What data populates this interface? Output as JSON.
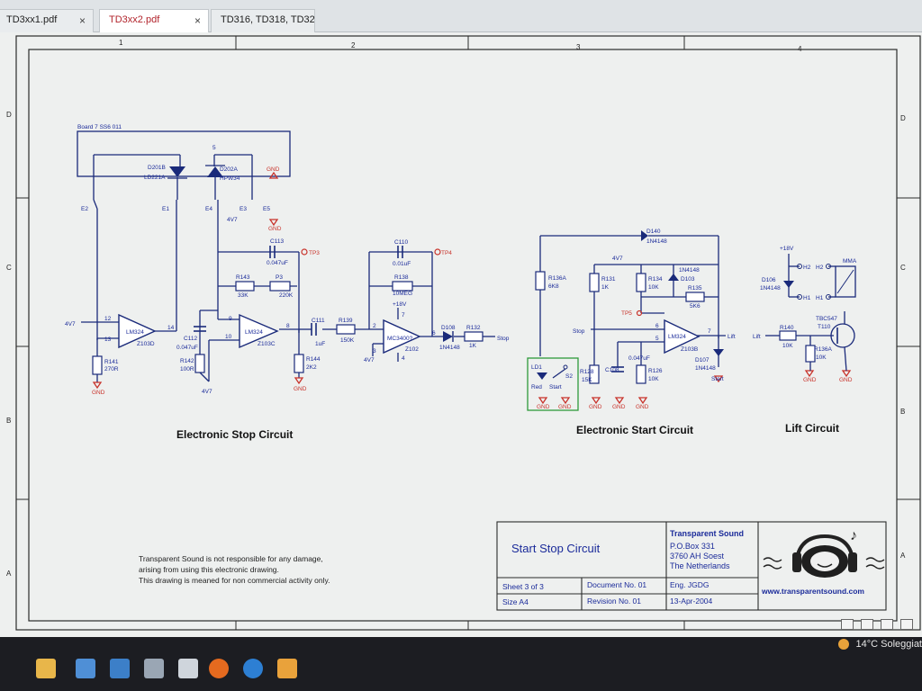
{
  "tabs": [
    {
      "label": "TD3xx1.pdf",
      "close": "×"
    },
    {
      "label": "TD3xx2.pdf",
      "close": "×"
    },
    {
      "label": "TD316, TD318, TD320, TD...",
      "close": ""
    }
  ],
  "schematic": {
    "zones_top": [
      "1",
      "2",
      "3",
      "4"
    ],
    "zones_side": [
      "D",
      "C",
      "B",
      "A"
    ],
    "board_label": "Board 7 SS6 011",
    "stop_circuit": {
      "title": "Electronic Stop Circuit",
      "parts": [
        "D201B",
        "LD221A",
        "D202A",
        "HPW34",
        "GND",
        "E2",
        "E1",
        "E4",
        "E3",
        "E5",
        "4V7",
        "C113",
        "0.047uF",
        "TP3",
        "R143",
        "33K",
        "P3",
        "220K",
        "LM324",
        "Z103D",
        "LM324",
        "Z103C",
        "C112",
        "0.047uF",
        "R142",
        "100R",
        "R141",
        "270R",
        "R144",
        "2K2",
        "C111",
        "1uF",
        "R139",
        "150K",
        "C110",
        "0.01uF",
        "TP4",
        "R138",
        "10MEG",
        "+18V",
        "MC3400?",
        "Z102",
        "D108",
        "1N4148",
        "R132",
        "1K",
        "Stop",
        "4V7"
      ],
      "pins": [
        "12",
        "13",
        "14",
        "9",
        "10",
        "8",
        "2",
        "3",
        "6",
        "7",
        "4",
        "5"
      ]
    },
    "start_circuit": {
      "title": "Electronic Start Circuit",
      "parts": [
        "D140",
        "1N4148",
        "4V7",
        "R136A",
        "6K8",
        "R131",
        "1K",
        "R134",
        "10K",
        "1N4148",
        "D103",
        "R135",
        "5K6",
        "TP5",
        "Stop",
        "LM324",
        "Z103B",
        "Lift",
        "D107",
        "1N4148",
        "Start",
        "R128",
        "15K",
        "C108",
        "0.047uF",
        "R126",
        "10K",
        "LD1",
        "Red",
        "S2",
        "Start"
      ],
      "pins": [
        "6",
        "5",
        "7"
      ]
    },
    "lift_circuit": {
      "title": "Lift Circuit",
      "parts": [
        "+18V",
        "MMA",
        "H2",
        "H2",
        "H1",
        "H1",
        "D106",
        "1N4148",
        "R140",
        "10K",
        "Lift",
        "TBC547",
        "T110",
        "R136A",
        "10K"
      ]
    },
    "disclaimer": [
      "Transparent Sound is not responsible for any damage,",
      "arising from using this electronic drawing.",
      "This drawing is meaned for non commercial activity only."
    ],
    "title_block": {
      "title": "Start Stop Circuit",
      "company": "Transparent Sound",
      "address": [
        "P.O.Box 331",
        "3760 AH Soest",
        "The Netherlands"
      ],
      "website": "www.transparentsound.com",
      "sheet": "Sheet 3 of 3",
      "document": "Document  No. 01",
      "eng": "Eng. JGDG",
      "size": "Size    A4",
      "revision": "Revision  No. 01",
      "date": "13-Apr-2004"
    },
    "gnd": "GND"
  },
  "taskbar": {
    "weather": "14°C  Soleggiat"
  },
  "colors": {
    "wire": "#1a2a7a",
    "label": "#1b2b9a",
    "ground": "#c8322a",
    "border": "#2b2b2b",
    "paper": "#eef0ef",
    "startbox": "#2e9a3a"
  }
}
